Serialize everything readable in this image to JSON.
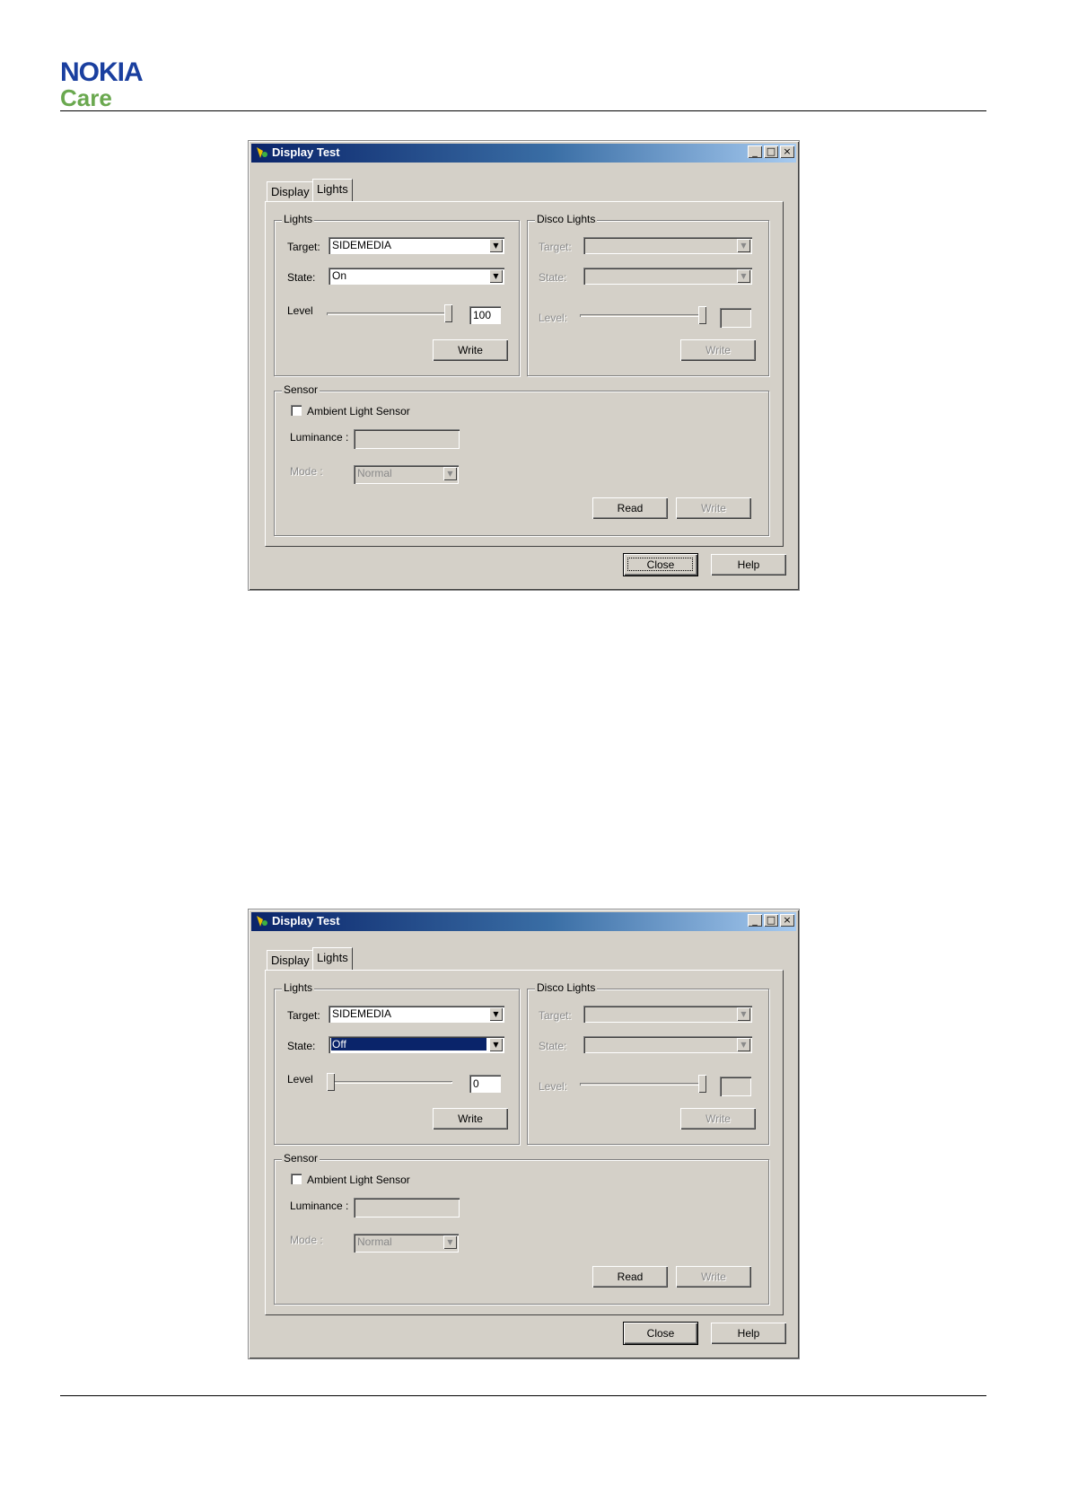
{
  "brand": {
    "logo_line1": "NOKIA",
    "logo_line2": "Care"
  },
  "dialogs": [
    {
      "title": "Display Test",
      "title_buttons": [
        "_",
        "□",
        "×"
      ],
      "tabs": [
        "Display",
        "Lights"
      ],
      "active_tab": "Lights",
      "lights": {
        "group_label": "Lights",
        "target_label": "Target:",
        "target_value": "SIDEMEDIA",
        "state_label": "State:",
        "state_value": "On",
        "level_label": "Level",
        "level_value": "100",
        "level_fraction": 1.0,
        "write_label": "Write"
      },
      "disco": {
        "group_label": "Disco Lights",
        "target_label": "Target:",
        "state_label": "State:",
        "level_label": "Level:",
        "write_label": "Write"
      },
      "sensor": {
        "group_label": "Sensor",
        "checkbox_label": "Ambient Light Sensor",
        "luminance_label": "Luminance :",
        "mode_label": "Mode :",
        "mode_value": "Normal",
        "read_label": "Read",
        "write_label": "Write"
      },
      "close_label": "Close",
      "help_label": "Help"
    },
    {
      "title": "Display Test",
      "title_buttons": [
        "_",
        "□",
        "×"
      ],
      "tabs": [
        "Display",
        "Lights"
      ],
      "active_tab": "Lights",
      "lights": {
        "group_label": "Lights",
        "target_label": "Target:",
        "target_value": "SIDEMEDIA",
        "state_label": "State:",
        "state_value": "Off",
        "level_label": "Level",
        "level_value": "0",
        "level_fraction": 0.0,
        "write_label": "Write"
      },
      "disco": {
        "group_label": "Disco Lights",
        "target_label": "Target:",
        "state_label": "State:",
        "level_label": "Level:",
        "write_label": "Write"
      },
      "sensor": {
        "group_label": "Sensor",
        "checkbox_label": "Ambient Light Sensor",
        "luminance_label": "Luminance :",
        "mode_label": "Mode :",
        "mode_value": "Normal",
        "read_label": "Read",
        "write_label": "Write"
      },
      "close_label": "Close",
      "help_label": "Help"
    }
  ]
}
